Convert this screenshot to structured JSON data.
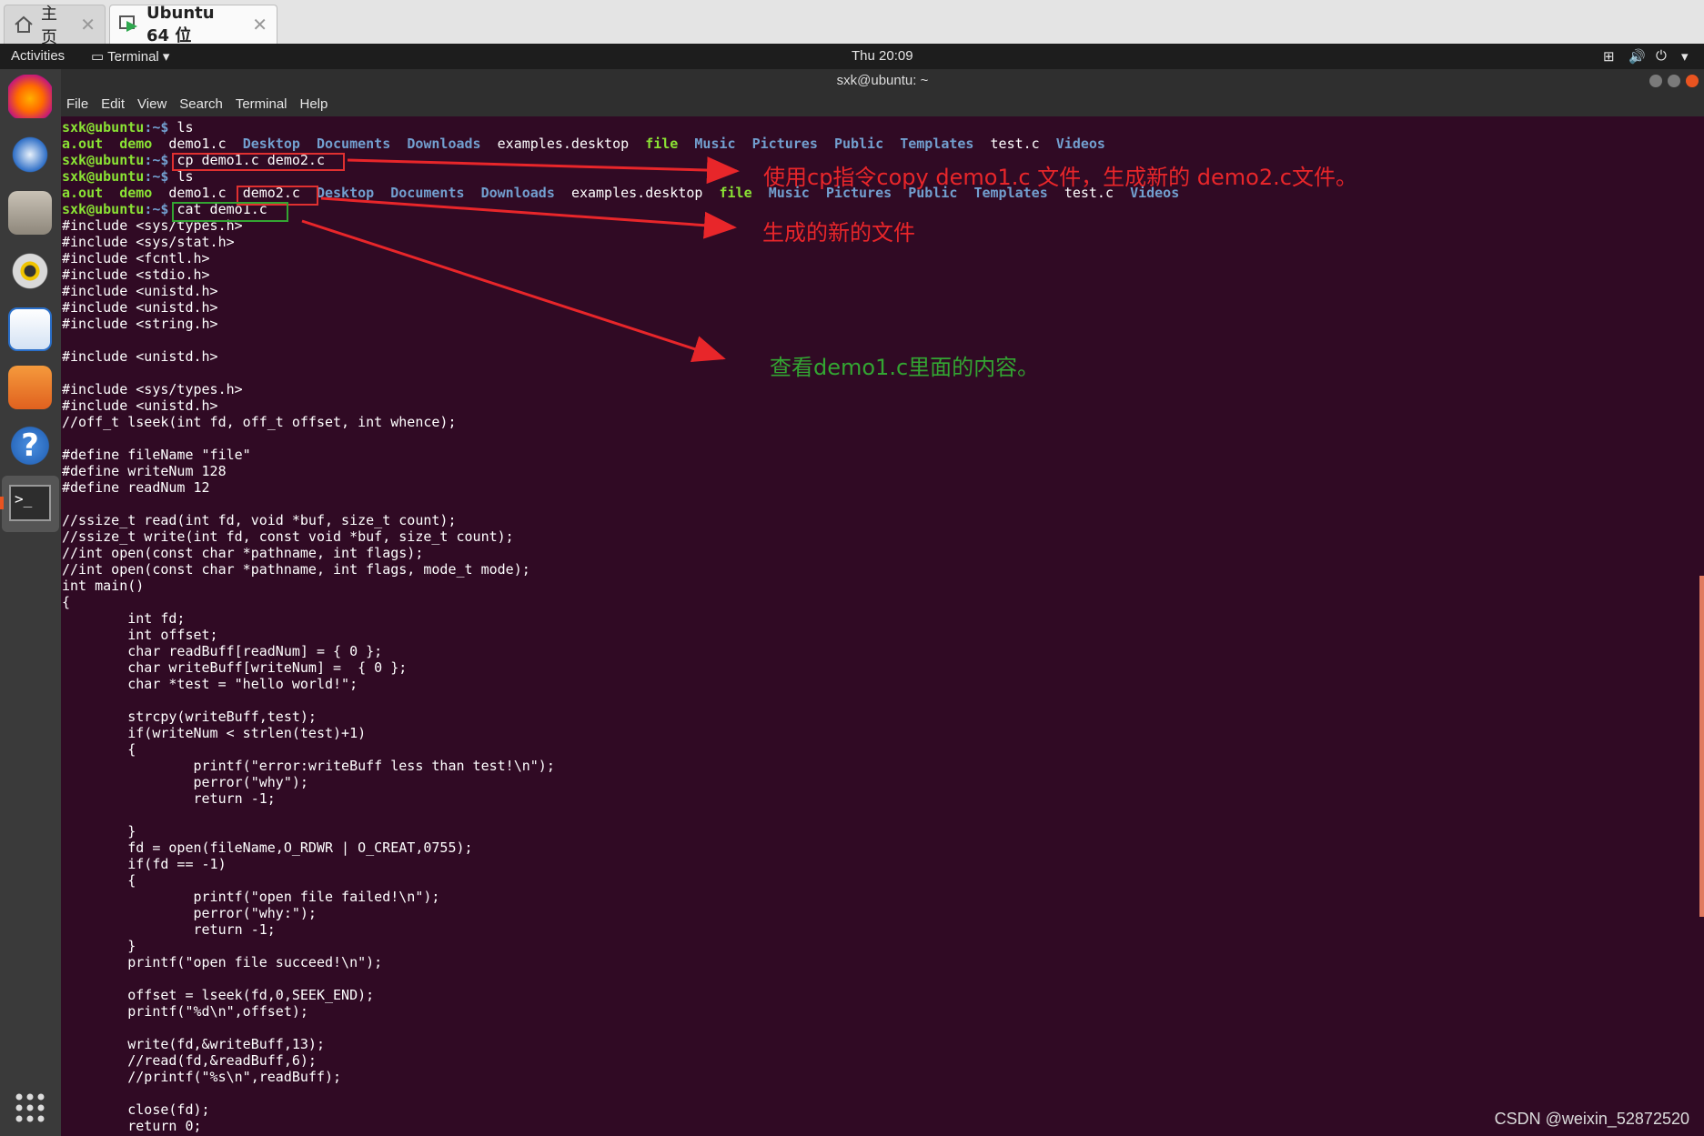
{
  "host_tabs": [
    {
      "label": "主页",
      "icon": "home-icon"
    },
    {
      "label": "Ubuntu 64 位",
      "icon": "vm-icon"
    }
  ],
  "topbar": {
    "activities": "Activities",
    "app_menu": "Terminal",
    "clock": "Thu 20:09"
  },
  "window": {
    "title": "sxk@ubuntu: ~",
    "menu": [
      "File",
      "Edit",
      "View",
      "Search",
      "Terminal",
      "Help"
    ]
  },
  "dock": [
    "firefox-icon",
    "thunderbird-icon",
    "files-icon",
    "rhythmbox-icon",
    "libreoffice-writer-icon",
    "software-center-icon",
    "help-icon",
    "terminal-icon",
    "show-apps-icon"
  ],
  "terminal": {
    "prompt_user": "sxk@ubuntu",
    "prompt_path": ":~$",
    "commands": [
      "ls",
      "cp demo1.c demo2.c",
      "ls",
      "cat demo1.c"
    ],
    "ls1": [
      "a.out",
      "demo",
      "demo1.c",
      "Desktop",
      "Documents",
      "Downloads",
      "examples.desktop",
      "file",
      "Music",
      "Pictures",
      "Public",
      "Templates",
      "test.c",
      "Videos"
    ],
    "ls2": [
      "a.out",
      "demo",
      "demo1.c",
      "demo2.c",
      "Desktop",
      "Documents",
      "Downloads",
      "examples.desktop",
      "file",
      "Music",
      "Pictures",
      "Public",
      "Templates",
      "test.c",
      "Videos"
    ],
    "code": [
      "#include <sys/types.h>",
      "#include <sys/stat.h>",
      "#include <fcntl.h>",
      "#include <stdio.h>",
      "#include <unistd.h>",
      "#include <unistd.h>",
      "#include <string.h>",
      "",
      "#include <unistd.h>",
      "",
      "#include <sys/types.h>",
      "#include <unistd.h>",
      "//off_t lseek(int fd, off_t offset, int whence);",
      "",
      "#define fileName \"file\"",
      "#define writeNum 128",
      "#define readNum 12",
      "",
      "//ssize_t read(int fd, void *buf, size_t count);",
      "//ssize_t write(int fd, const void *buf, size_t count);",
      "//int open(const char *pathname, int flags);",
      "//int open(const char *pathname, int flags, mode_t mode);",
      "int main()",
      "{",
      "        int fd;",
      "        int offset;",
      "        char readBuff[readNum] = { 0 };",
      "        char writeBuff[writeNum] =  { 0 };",
      "        char *test = \"hello world!\";",
      "",
      "        strcpy(writeBuff,test);",
      "        if(writeNum < strlen(test)+1)",
      "        {",
      "                printf(\"error:writeBuff less than test!\\n\");",
      "                perror(\"why\");",
      "                return -1;",
      "",
      "        }",
      "        fd = open(fileName,O_RDWR | O_CREAT,0755);",
      "        if(fd == -1)",
      "        {",
      "                printf(\"open file failed!\\n\");",
      "                perror(\"why:\");",
      "                return -1;",
      "        }",
      "        printf(\"open file succeed!\\n\");",
      "",
      "        offset = lseek(fd,0,SEEK_END);",
      "        printf(\"%d\\n\",offset);",
      "",
      "        write(fd,&writeBuff,13);",
      "        //read(fd,&readBuff,6);",
      "        //printf(\"%s\\n\",readBuff);",
      "",
      "        close(fd);",
      "        return 0;"
    ]
  },
  "annotations": {
    "a1": "使用cp指令copy demo1.c 文件，生成新的 demo2.c文件。",
    "a2": "生成的新的文件",
    "a3": "查看demo1.c里面的内容。",
    "color_red": "#e8262a",
    "color_green": "#33a532"
  },
  "watermark": "CSDN @weixin_52872520"
}
